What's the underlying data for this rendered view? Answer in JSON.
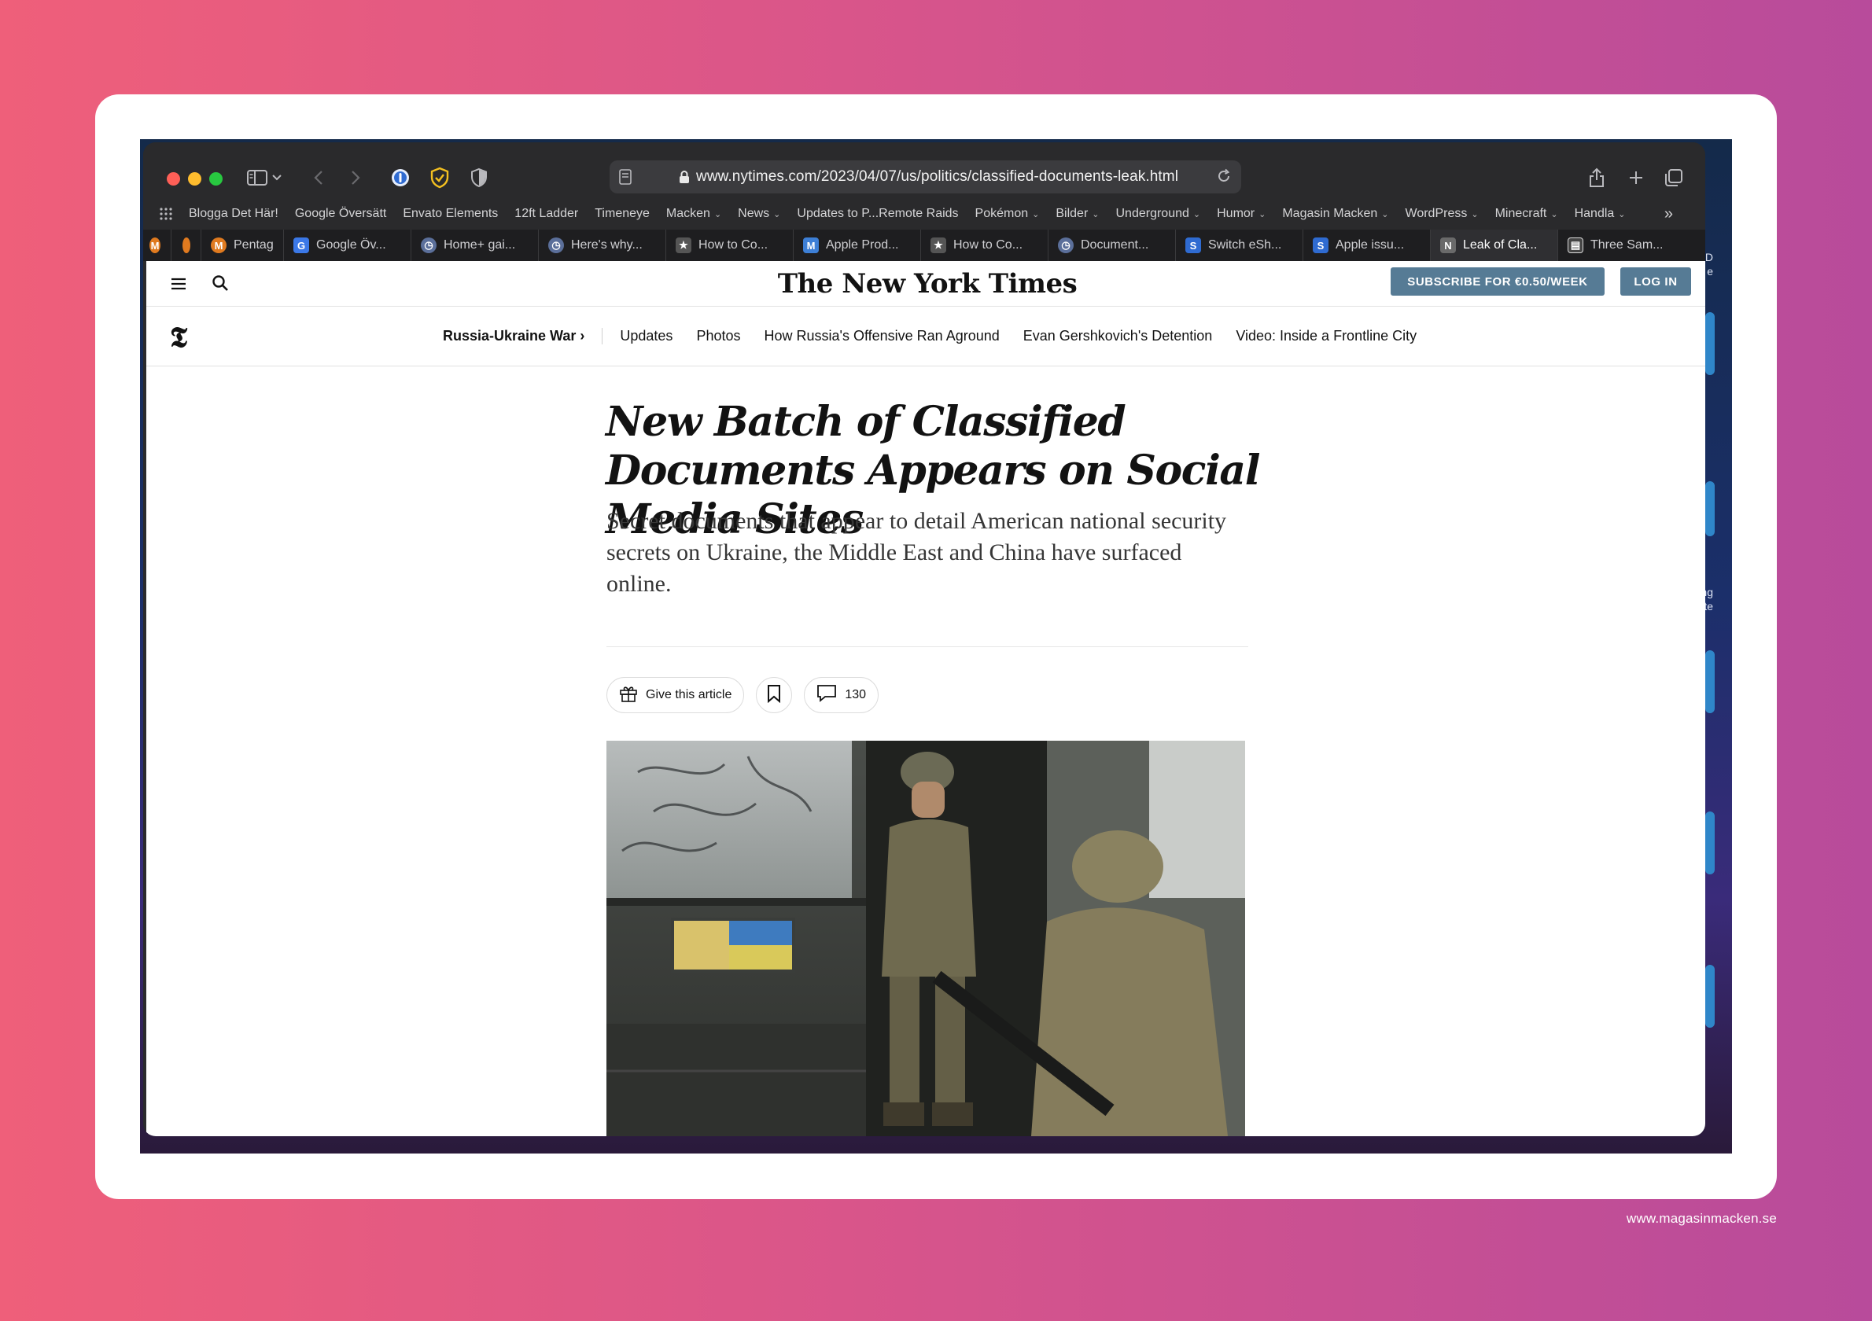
{
  "browser": {
    "url": "www.nytimes.com/2023/04/07/us/politics/classified-documents-leak.html",
    "favorites": [
      {
        "label": "Blogga Det Här!",
        "menu": false
      },
      {
        "label": "Google Översätt",
        "menu": false
      },
      {
        "label": "Envato Elements",
        "menu": false
      },
      {
        "label": "12ft Ladder",
        "menu": false
      },
      {
        "label": "Timeneye",
        "menu": false
      },
      {
        "label": "Macken",
        "menu": true
      },
      {
        "label": "News",
        "menu": true
      },
      {
        "label": "Updates to P...Remote Raids",
        "menu": false
      },
      {
        "label": "Pokémon",
        "menu": true
      },
      {
        "label": "Bilder",
        "menu": true
      },
      {
        "label": "Underground",
        "menu": true
      },
      {
        "label": "Humor",
        "menu": true
      },
      {
        "label": "Magasin Macken",
        "menu": true
      },
      {
        "label": "WordPress",
        "menu": true
      },
      {
        "label": "Minecraft",
        "menu": true
      },
      {
        "label": "Handla",
        "menu": true
      }
    ],
    "tabs": [
      {
        "label": "",
        "icon": "M",
        "color": "#e07a1f"
      },
      {
        "label": "",
        "icon": "",
        "color": "#e07a1f"
      },
      {
        "label": "Pentag",
        "icon": "M",
        "color": "#e07a1f"
      },
      {
        "label": "Google Öv...",
        "icon": "G",
        "color": "#3b78e7"
      },
      {
        "label": "Home+ gai...",
        "icon": "◷",
        "color": "#5b6f9a"
      },
      {
        "label": "Here's why...",
        "icon": "◷",
        "color": "#5b6f9a"
      },
      {
        "label": "How to Co...",
        "icon": "★",
        "color": "#555"
      },
      {
        "label": "Apple Prod...",
        "icon": "M",
        "color": "#3d7fd6"
      },
      {
        "label": "How to Co...",
        "icon": "★",
        "color": "#555"
      },
      {
        "label": "Document...",
        "icon": "◷",
        "color": "#5b6f9a"
      },
      {
        "label": "Switch eSh...",
        "icon": "S",
        "color": "#2f6bd1"
      },
      {
        "label": "Apple issu...",
        "icon": "S",
        "color": "#2f6bd1"
      },
      {
        "label": "Leak of Cla...",
        "icon": "N",
        "color": "#6a6a6a",
        "active": true
      },
      {
        "label": "Three Sam...",
        "icon": "▤",
        "color": "#444"
      }
    ]
  },
  "site": {
    "logo": "The New York Times",
    "subscribe_label": "SUBSCRIBE FOR €0.50/WEEK",
    "login_label": "LOG IN",
    "section_label": "Russia-Ukraine War ›",
    "nav_links": [
      "Updates",
      "Photos",
      "How Russia's Offensive Ran Aground",
      "Evan Gershkovich's Detention",
      "Video: Inside a Frontline City"
    ]
  },
  "article": {
    "headline": "New Batch of Classified Documents Appears on Social Media Sites",
    "summary": "Secret documents that appear to detail American national security secrets on Ukraine, the Middle East and China have surfaced online.",
    "gift_label": "Give this article",
    "comments_count": "130"
  },
  "screen_edge": {
    "text_1": "D",
    "text_2": "e",
    "text_3": "ng",
    "text_4": "te"
  },
  "footer": {
    "credit": "www.magasinmacken.se"
  },
  "colors": {
    "accent": "#567b95",
    "bg_start": "#ef5f7a",
    "bg_end": "#b84b9b"
  },
  "icons": [
    "sidebar-icon",
    "back-icon",
    "forward-icon",
    "onepassword-icon",
    "shield-check-icon",
    "privacy-shield-icon",
    "reader-icon",
    "lock-icon",
    "reload-icon",
    "share-icon",
    "plus-icon",
    "tabs-overview-icon",
    "grid-icon",
    "hamburger-icon",
    "search-icon",
    "gift-icon",
    "bookmark-icon",
    "comment-icon"
  ]
}
